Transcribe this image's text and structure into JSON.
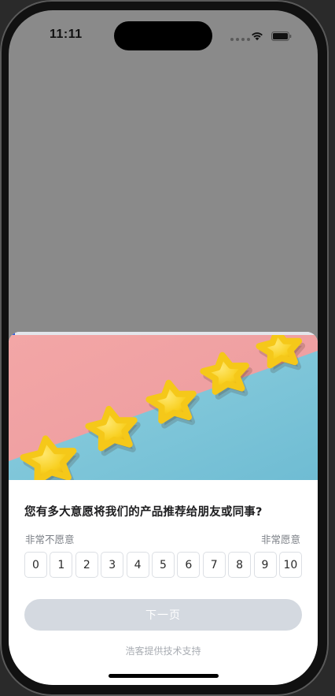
{
  "status_bar": {
    "time": "11:11",
    "icons": [
      "signal-icon",
      "wifi-icon",
      "battery-icon"
    ]
  },
  "survey": {
    "progress": 0.02,
    "banner_image": "yellow-stars-on-pink-and-blue-background",
    "question": "您有多大意愿将我们的产品推荐给朋友或同事?",
    "label_low": "非常不愿意",
    "label_high": "非常愿意",
    "options": [
      "0",
      "1",
      "2",
      "3",
      "4",
      "5",
      "6",
      "7",
      "8",
      "9",
      "10"
    ],
    "next_button": "下一页",
    "next_enabled": false,
    "powered_by": "浩客提供技术支持"
  },
  "colors": {
    "accent": "#2f5bd9",
    "button_disabled": "#d4d9e0",
    "overlay": "#8a8a8a"
  }
}
